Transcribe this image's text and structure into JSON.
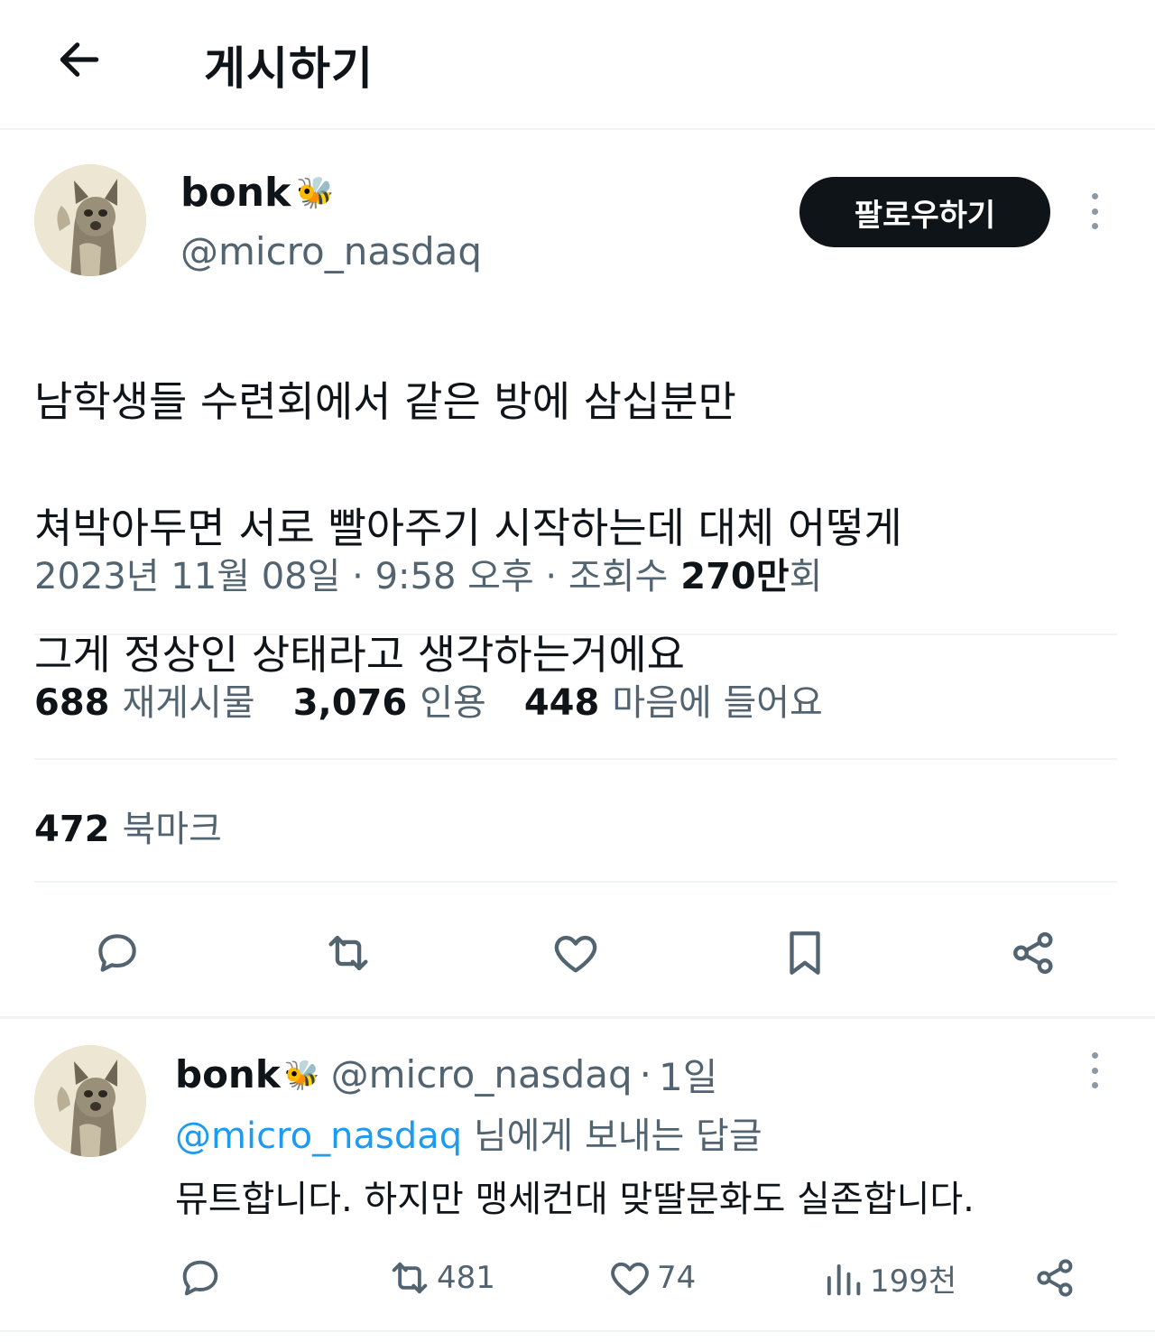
{
  "header": {
    "title": "게시하기",
    "back_icon": "arrow-left-icon"
  },
  "tweet": {
    "author_name": "bonk",
    "author_emoji": "🐝",
    "author_handle": "@micro_nasdaq",
    "follow_label": "팔로우하기",
    "text_lines": [
      "남학생들 수련회에서 같은 방에 삼십분만",
      "쳐박아두면 서로 빨아주기 시작하는데 대체 어떻게",
      "그게 정상인 상태라고 생각하는거에요"
    ],
    "meta_date": "2023년 11월 08일 · 9:58 오후 · 조회수",
    "views_num": "270",
    "views_unit": "만",
    "views_suffix": "회",
    "stats": {
      "retweets_num": "688",
      "retweets_label": "재게시물",
      "quotes_num": "3,076",
      "quotes_label": "인용",
      "likes_num": "448",
      "likes_label": "마음에 들어요",
      "bookmarks_num": "472",
      "bookmarks_label": "북마크"
    },
    "action_icons": [
      "reply-icon",
      "retweet-icon",
      "like-icon",
      "bookmark-icon",
      "share-icon"
    ]
  },
  "reply": {
    "author_name": "bonk",
    "author_emoji": "🐝",
    "author_handle": "@micro_nasdaq",
    "dot": "·",
    "time": "1일",
    "replying_mention": "@micro_nasdaq",
    "replying_suffix": " 님에게 보내는 답글",
    "text": "뮤트합니다. 하지만 맹세컨대 맞딸문화도 실존합니다.",
    "retweets": "481",
    "likes": "74",
    "views": "199천"
  },
  "colors": {
    "text": "#0f1419",
    "secondary": "#536471",
    "link": "#1d9bf0",
    "divider": "#eff3f4",
    "button_bg": "#0f1419"
  }
}
